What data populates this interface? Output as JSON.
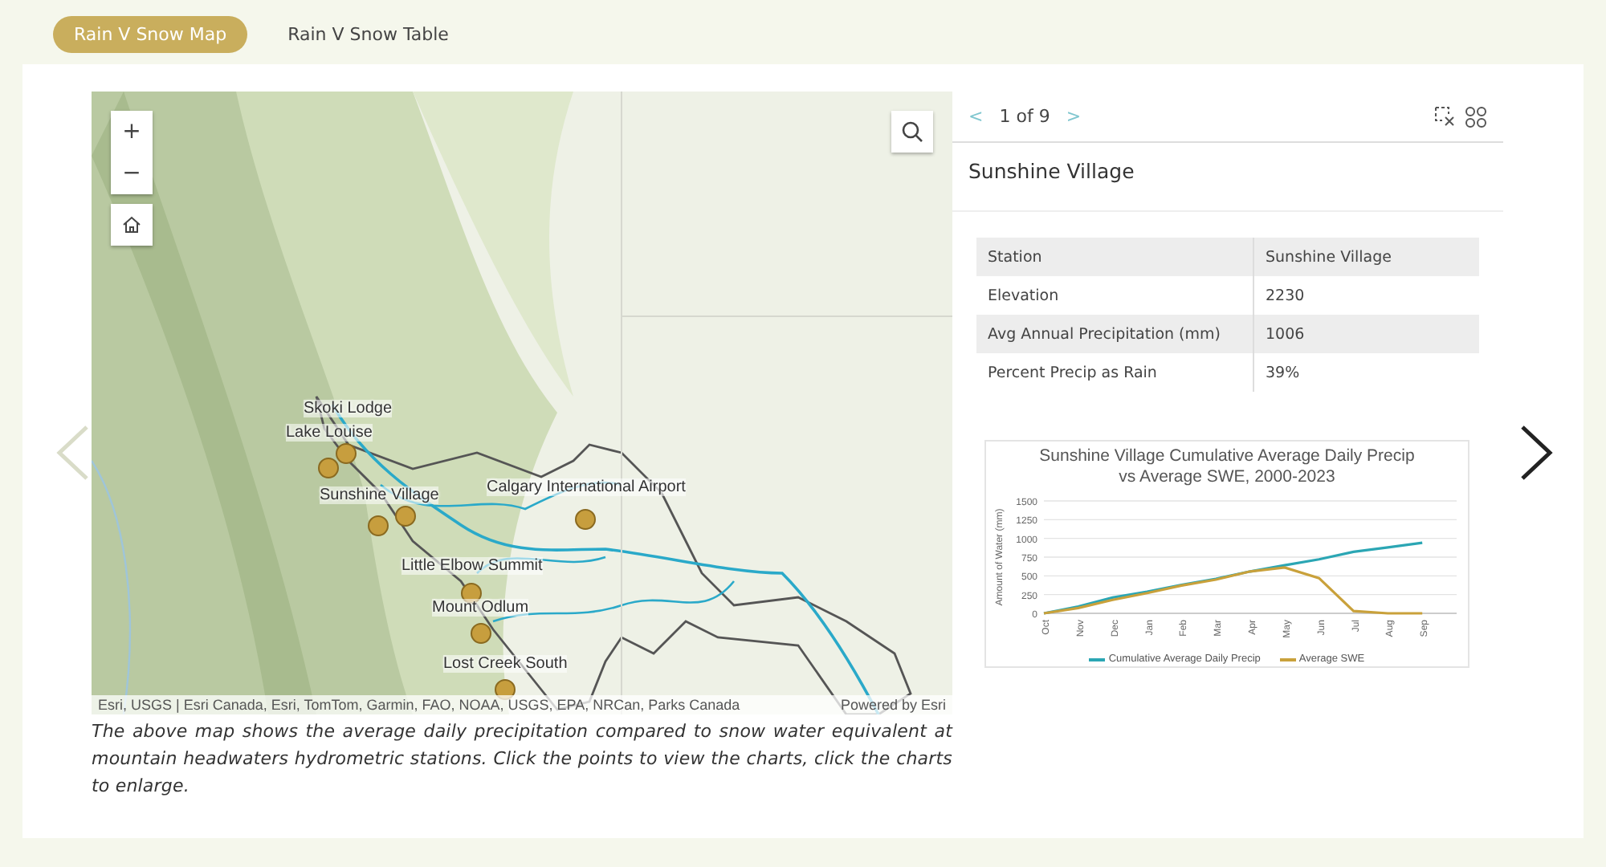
{
  "tabs": [
    {
      "label": "Rain V Snow Map",
      "selected": true
    },
    {
      "label": "Rain V Snow Table",
      "selected": false
    }
  ],
  "map": {
    "zoom_in": "+",
    "zoom_out": "−",
    "stations": [
      {
        "label": "Skoki Lodge"
      },
      {
        "label": "Lake Louise"
      },
      {
        "label": "Sunshine Village"
      },
      {
        "label": "Calgary International Airport"
      },
      {
        "label": "Little Elbow Summit"
      },
      {
        "label": "Mount Odlum"
      },
      {
        "label": "Lost Creek South"
      }
    ],
    "attribution": "Esri, USGS | Esri Canada, Esri, TomTom, Garmin, FAO, NOAA, USGS, EPA, NRCan, Parks Canada",
    "powered_by": "Powered by Esri"
  },
  "caption": "The above map shows the average daily precipitation compared to snow water equivalent at mountain headwaters hydrometric stations. Click the points to view the charts, click the charts to enlarge.",
  "popup": {
    "pager": {
      "prev": "<",
      "count": "1 of 9",
      "next": ">"
    },
    "title": "Sunshine Village",
    "fields": [
      {
        "label": "Station",
        "value": "Sunshine Village"
      },
      {
        "label": "Elevation",
        "value": "2230"
      },
      {
        "label": "Avg Annual Precipitation (mm)",
        "value": "1006"
      },
      {
        "label": "Percent Precip as Rain",
        "value": "39%"
      }
    ],
    "chart_data": {
      "type": "line",
      "grid": true,
      "legend": "bottom",
      "title": "Sunshine Village Cumulative Average Daily Precip vs Average SWE, 2000-2023",
      "ylabel": "Amount of Water (mm)",
      "categories": [
        "Oct",
        "Nov",
        "Dec",
        "Jan",
        "Feb",
        "Mar",
        "Apr",
        "May",
        "Jun",
        "Jul",
        "Aug",
        "Sep"
      ],
      "ylim": [
        0,
        1500
      ],
      "yticks": [
        0,
        250,
        500,
        750,
        1000,
        1250,
        1500
      ],
      "series": [
        {
          "name": "Cumulative Average Daily Precip",
          "color": "#2ba6b4",
          "values": [
            0,
            90,
            210,
            290,
            380,
            460,
            560,
            640,
            720,
            820,
            880,
            940
          ]
        },
        {
          "name": "Average SWE",
          "color": "#c9a13b",
          "values": [
            0,
            70,
            180,
            270,
            370,
            450,
            560,
            610,
            470,
            30,
            0,
            0
          ]
        }
      ]
    }
  }
}
